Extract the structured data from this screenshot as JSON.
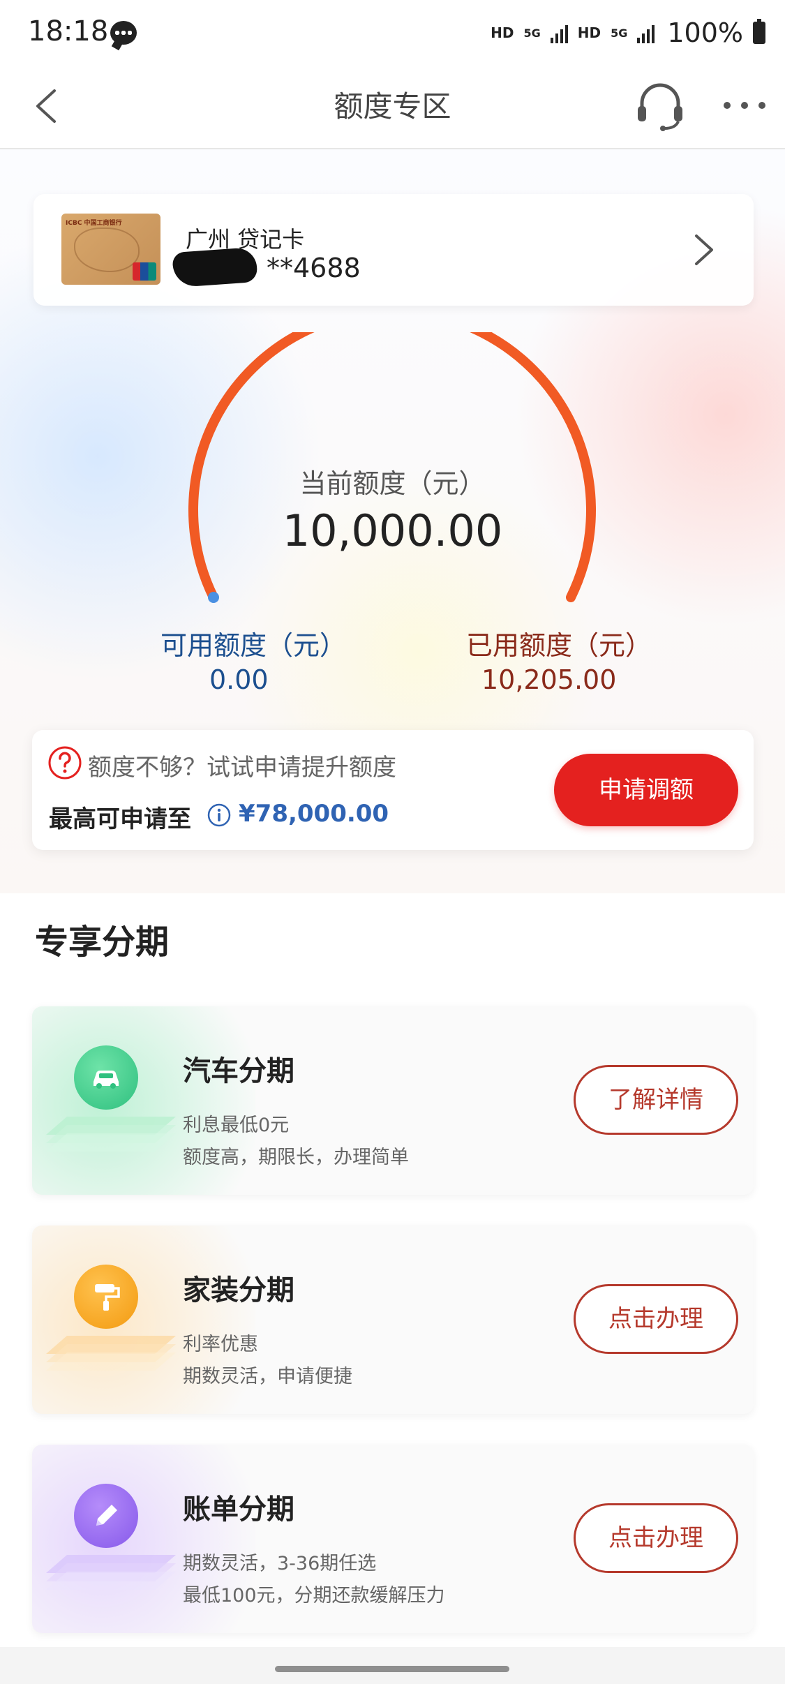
{
  "status_bar": {
    "time": "18:18",
    "network1": "HD",
    "network1_gen": "5G",
    "network2": "HD",
    "network2_gen": "5G",
    "battery": "100%"
  },
  "nav": {
    "title": "额度专区",
    "icons": [
      "chevron-left-icon",
      "headset-icon",
      "more-icon"
    ]
  },
  "card": {
    "name": "广州 贷记卡",
    "number_suffix": "**4688",
    "thumb_logo_text": "ICBC 中国工商银行"
  },
  "credit": {
    "current_label": "当前额度（元）",
    "current_value": "10,000.00",
    "available_label": "可用额度（元）",
    "available_value": "0.00",
    "used_label": "已用额度（元）",
    "used_value": "10,205.00",
    "gauge_color": "#f15a24",
    "gauge_start_color": "#4a90e2"
  },
  "raise": {
    "prompt": "额度不够？试试申请提升额度",
    "max_label": "最高可申请至",
    "max_value": "¥78,000.00",
    "button": "申请调额",
    "accent": "#e4211f"
  },
  "section": {
    "title": "专享分期"
  },
  "installments": [
    {
      "title": "汽车分期",
      "desc1": "利息最低0元",
      "desc2": "额度高，期限长，办理简单",
      "button": "了解详情",
      "icon": "car-icon",
      "color": "#3ccf8e"
    },
    {
      "title": "家装分期",
      "desc1": "利率优惠",
      "desc2": "期数灵活，申请便捷",
      "button": "点击办理",
      "icon": "paint-roller-icon",
      "color": "#f6a421"
    },
    {
      "title": "账单分期",
      "desc1": "期数灵活，3-36期任选",
      "desc2": "最低100元，分期还款缓解压力",
      "button": "点击办理",
      "icon": "pencil-icon",
      "color": "#9b6cf0"
    }
  ]
}
